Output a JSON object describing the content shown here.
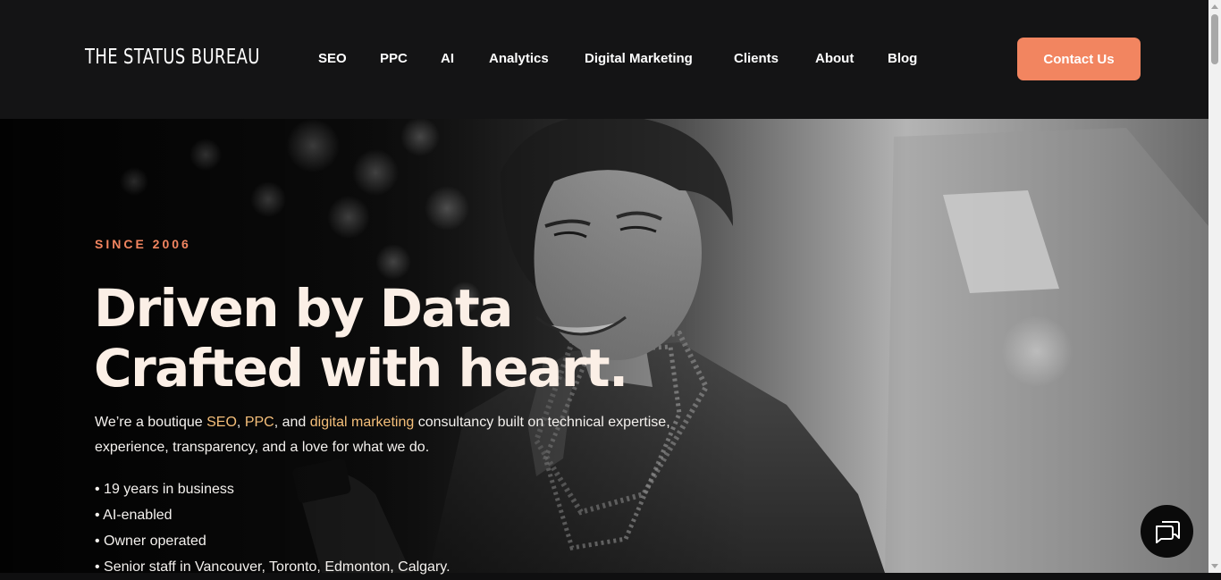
{
  "header": {
    "logo": "THE STATUS BUREAU",
    "nav": [
      "SEO",
      "PPC",
      "AI",
      "Analytics",
      "Digital Marketing",
      "Clients",
      "About",
      "Blog"
    ],
    "cta": "Contact Us"
  },
  "hero": {
    "eyebrow": "SINCE 2006",
    "headline_line1": "Driven by Data",
    "headline_line2": "Crafted with heart.",
    "intro": {
      "t1": "We’re a boutique ",
      "seo": "SEO",
      "comma": ", ",
      "ppc": "PPC",
      "t2": ", and ",
      "dm": "digital marketing",
      "t3": " consultancy built on technical expertise, experience, transparency, and a love for what we do."
    },
    "bullets": [
      "• 19 years in business",
      "• AI-enabled",
      "• Owner operated",
      "• Senior staff in Vancouver, Toronto, Edmonton, Calgary."
    ]
  },
  "icons": {
    "chat": "chat-bubbles-icon"
  },
  "colors": {
    "accent": "#f28560",
    "highlight": "#f5bf7a",
    "header_bg": "#141415"
  }
}
